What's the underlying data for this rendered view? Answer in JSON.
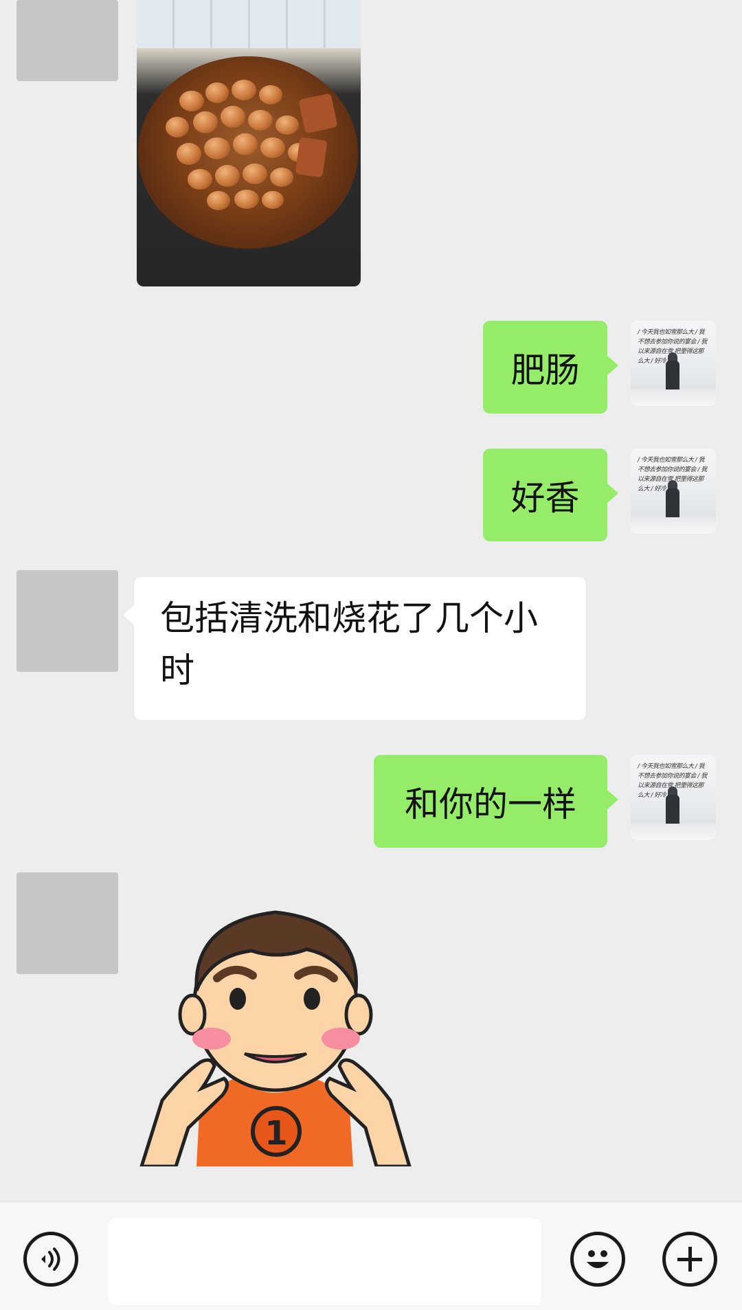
{
  "messages": [
    {
      "side": "left",
      "type": "image",
      "content": "braised pork intestines in pan"
    },
    {
      "side": "right",
      "type": "text",
      "text": "肥肠"
    },
    {
      "side": "right",
      "type": "text",
      "text": "好香"
    },
    {
      "side": "left",
      "type": "text",
      "text_line1": "包括清洗和烧花了几个小",
      "text_line2": "时"
    },
    {
      "side": "right",
      "type": "text",
      "text": "和你的一样"
    },
    {
      "side": "left",
      "type": "sticker",
      "content": "cartoon boy pinching cheeks"
    }
  ],
  "self_avatar_text": "/ 今天我也如雪那么大 / 我不想去参加你说的宴会 / 我以来源自在雪 把里得这那么大 / 好冷",
  "input_bar": {
    "voice_icon": "voice-icon",
    "message_placeholder": "",
    "emoji_icon": "emoji-icon",
    "plus_icon": "plus-icon"
  },
  "colors": {
    "background": "#ededed",
    "self_bubble": "#95ec69",
    "other_bubble": "#ffffff",
    "avatar_placeholder": "#c6c6c6"
  }
}
